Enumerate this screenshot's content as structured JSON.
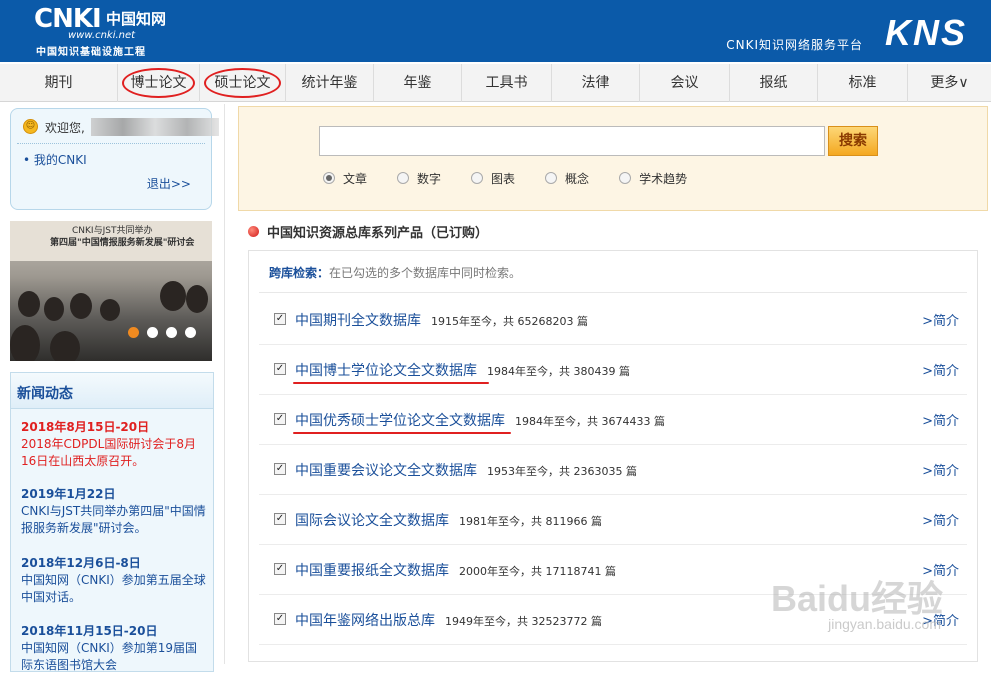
{
  "header": {
    "logo_main": "CNKI",
    "logo_cn": "中国知网",
    "logo_url": "www.cnki.net",
    "logo_sub": "中国知识基础设施工程",
    "platform": "CNKI知识网络服务平台",
    "brand": "KNS",
    "bg_color": "#0b5aa9"
  },
  "nav": {
    "items": [
      {
        "label": "期刊"
      },
      {
        "label": "博士论文"
      },
      {
        "label": "硕士论文"
      },
      {
        "label": "统计年鉴"
      },
      {
        "label": "年鉴"
      },
      {
        "label": "工具书"
      },
      {
        "label": "法律"
      },
      {
        "label": "会议"
      },
      {
        "label": "报纸"
      },
      {
        "label": "标准"
      },
      {
        "label": "更多∨"
      }
    ]
  },
  "welcome": {
    "greeting": "欢迎您,",
    "my_cnki": "• 我的CNKI",
    "logout": "退出>>"
  },
  "banner": {
    "line1": "CNKI与JST共同举办",
    "line2": "第四届\"中国情报服务新发展\"研讨会"
  },
  "news": {
    "title": "新闻动态",
    "items": [
      {
        "date": "2018年8月15日-20日",
        "desc": "2018年CDPDL国际研讨会于8月16日在山西太原召开。"
      },
      {
        "date": "2019年1月22日",
        "desc": "CNKI与JST共同举办第四届\"中国情报服务新发展\"研讨会。"
      },
      {
        "date": "2018年12月6日-8日",
        "desc": "中国知网（CNKI）参加第五届全球中国对话。"
      },
      {
        "date": "2018年11月15日-20日",
        "desc": "中国知网（CNKI）参加第19届国际东语图书馆大会"
      }
    ]
  },
  "search": {
    "input_value": "",
    "button": "搜索",
    "options": [
      "文章",
      "数字",
      "图表",
      "概念",
      "学术趋势"
    ],
    "selected": "文章"
  },
  "section": {
    "title": "中国知识资源总库系列产品（已订购）",
    "cross_label": "跨库检索：",
    "cross_hint": "在已勾选的多个数据库中同时检索。",
    "intro_label": ">简介",
    "databases": [
      {
        "name": "中国期刊全文数据库",
        "meta": "1915年至今，共 65268203 篇"
      },
      {
        "name": "中国博士学位论文全文数据库",
        "meta": "1984年至今，共 380439 篇"
      },
      {
        "name": "中国优秀硕士学位论文全文数据库",
        "meta": "1984年至今，共 3674433 篇"
      },
      {
        "name": "中国重要会议论文全文数据库",
        "meta": "1953年至今，共 2363035 篇"
      },
      {
        "name": "国际会议论文全文数据库",
        "meta": "1981年至今，共 811966 篇"
      },
      {
        "name": "中国重要报纸全文数据库",
        "meta": "2000年至今，共 17118741 篇"
      },
      {
        "name": "中国年鉴网络出版总库",
        "meta": "1949年至今，共 32523772 篇"
      }
    ]
  },
  "watermark": {
    "main": "Baidu经验",
    "sub": "jingyan.baidu.com"
  }
}
